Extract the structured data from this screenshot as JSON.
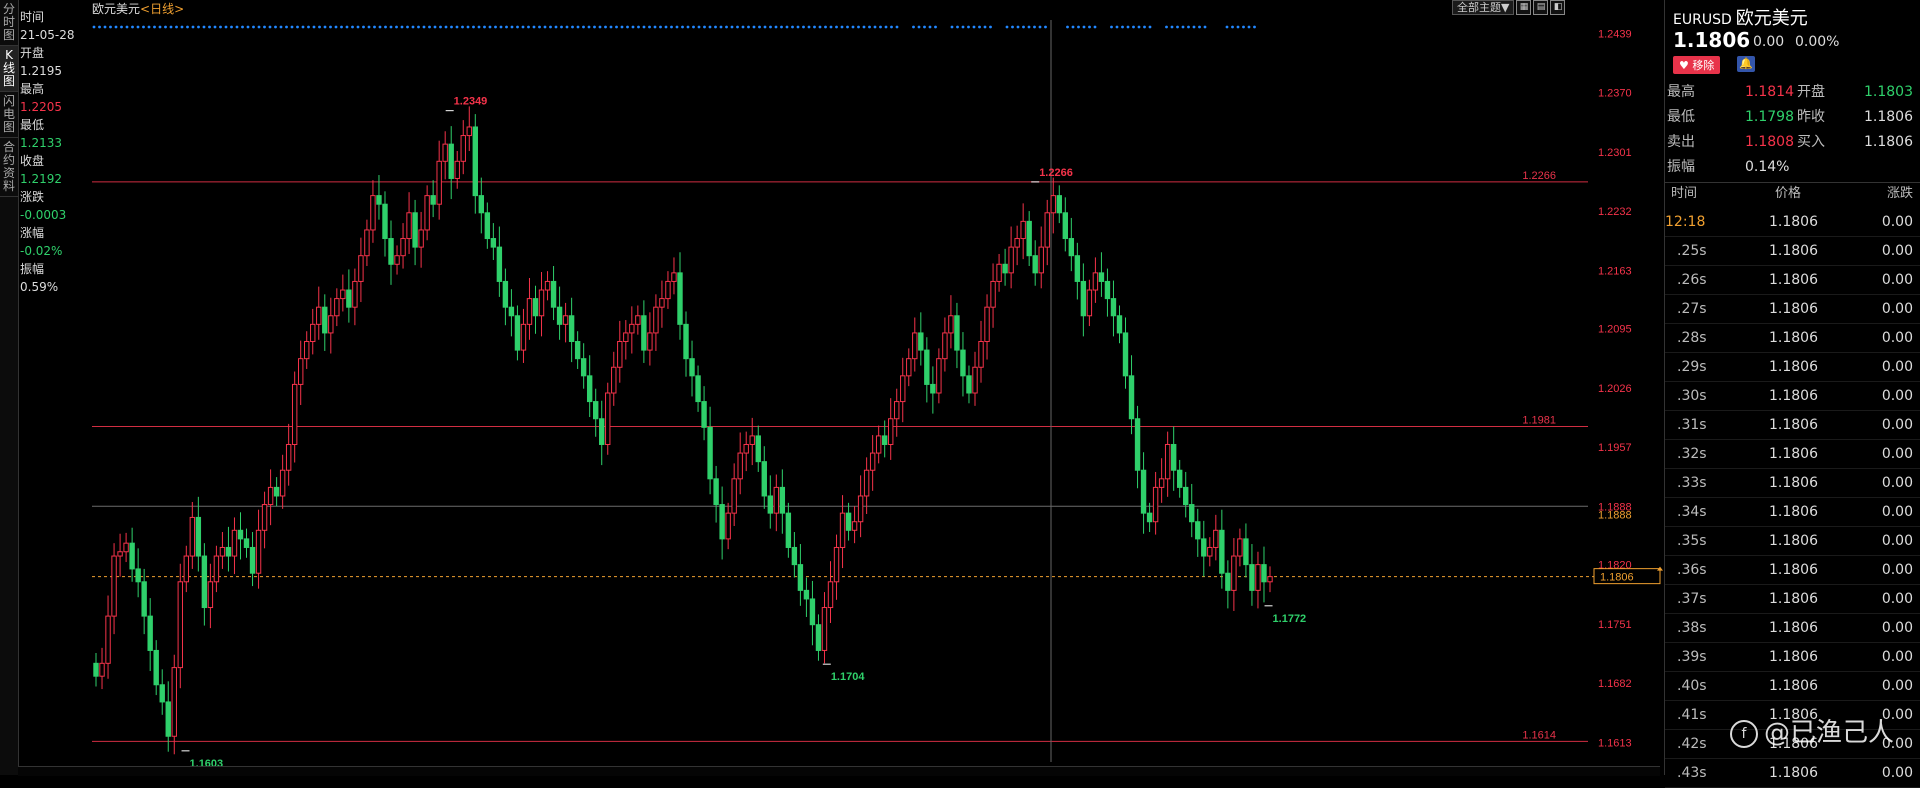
{
  "left_tabs": [
    "分时图",
    "K线图",
    "闪电图",
    "合约资料"
  ],
  "info": {
    "time_label": "时间",
    "time": "21-05-28",
    "open_label": "开盘",
    "open": "1.2195",
    "high_label": "最高",
    "high": "1.2205",
    "low_label": "最低",
    "low": "1.2133",
    "close_label": "收盘",
    "close": "1.2192",
    "change_label": "涨跌",
    "change": "-0.0003",
    "change_pct_label": "涨幅",
    "change_pct": "-0.02%",
    "amplitude_label": "振幅",
    "amplitude": "0.59%"
  },
  "chart_header": {
    "name": "欧元美元",
    "period": "<日线>"
  },
  "toolbar": {
    "theme_label": "全部主题▼",
    "icons": [
      "layout-icon",
      "layout2-icon",
      "close-icon"
    ]
  },
  "chart_data": {
    "type": "candlestick",
    "y_ticks_right": [
      "1.2439",
      "1.2370",
      "1.2301",
      "1.2232",
      "1.2163",
      "1.2095",
      "1.2026",
      "1.1957",
      "1.1888",
      "1.1820",
      "1.1751",
      "1.1682",
      "1.1613"
    ],
    "y_ticks_left": [
      "1.2095",
      "1.2026",
      "1.1957",
      "1.1888",
      "1.1820",
      "1.1751",
      "1.1682",
      "1.1613"
    ],
    "ylim": [
      1.159,
      1.245
    ],
    "hlines": [
      {
        "value": 1.2266,
        "label": "1.2266",
        "color": "#e8334a"
      },
      {
        "value": 1.1981,
        "label": "1.1981",
        "color": "#e8334a"
      },
      {
        "value": 1.1614,
        "label": "1.1614",
        "color": "#e8334a"
      },
      {
        "value": 1.1888,
        "label": "1.1888",
        "color": "#888888"
      }
    ],
    "current_price": {
      "value": 1.1806,
      "label": "1.1806",
      "upper_label": "1.1888"
    },
    "annotations": [
      {
        "label": "1.2349",
        "value": 1.2349,
        "color": "#f5334a",
        "pos": 0.241
      },
      {
        "label": "1.2266",
        "value": 1.2266,
        "color": "#f5334a",
        "pos": 0.64
      },
      {
        "label": "1.1603",
        "value": 1.1603,
        "color": "#2fd06b",
        "pos": 0.061
      },
      {
        "label": "1.1704",
        "value": 1.1704,
        "color": "#2fd06b",
        "pos": 0.498
      },
      {
        "label": "1.1772",
        "value": 1.1772,
        "color": "#2fd06b",
        "pos": 0.799
      }
    ],
    "closes": [
      1.169,
      1.1705,
      1.176,
      1.183,
      1.1835,
      1.1845,
      1.1815,
      1.18,
      1.176,
      1.172,
      1.168,
      1.166,
      1.162,
      1.17,
      1.18,
      1.183,
      1.1875,
      1.183,
      1.177,
      1.18,
      1.183,
      1.184,
      1.183,
      1.186,
      1.185,
      1.184,
      1.181,
      1.186,
      1.189,
      1.191,
      1.19,
      1.193,
      1.196,
      1.203,
      1.206,
      1.208,
      1.21,
      1.212,
      1.209,
      1.211,
      1.213,
      1.214,
      1.212,
      1.215,
      1.218,
      1.221,
      1.225,
      1.224,
      1.22,
      1.217,
      1.218,
      1.22,
      1.223,
      1.219,
      1.221,
      1.225,
      1.224,
      1.229,
      1.231,
      1.227,
      1.229,
      1.232,
      1.233,
      1.225,
      1.223,
      1.22,
      1.219,
      1.215,
      1.212,
      1.211,
      1.207,
      1.21,
      1.213,
      1.211,
      1.214,
      1.215,
      1.212,
      1.21,
      1.211,
      1.208,
      1.206,
      1.204,
      1.201,
      1.199,
      1.196,
      1.202,
      1.205,
      1.208,
      1.209,
      1.21,
      1.211,
      1.207,
      1.209,
      1.212,
      1.213,
      1.215,
      1.216,
      1.21,
      1.206,
      1.204,
      1.201,
      1.198,
      1.192,
      1.189,
      1.185,
      1.188,
      1.192,
      1.195,
      1.196,
      1.197,
      1.194,
      1.19,
      1.188,
      1.191,
      1.188,
      1.184,
      1.182,
      1.179,
      1.178,
      1.175,
      1.172,
      1.177,
      1.18,
      1.184,
      1.188,
      1.186,
      1.187,
      1.19,
      1.193,
      1.195,
      1.197,
      1.196,
      1.199,
      1.201,
      1.204,
      1.206,
      1.209,
      1.207,
      1.203,
      1.202,
      1.206,
      1.209,
      1.211,
      1.207,
      1.204,
      1.202,
      1.205,
      1.208,
      1.212,
      1.215,
      1.217,
      1.216,
      1.219,
      1.22,
      1.222,
      1.218,
      1.216,
      1.219,
      1.223,
      1.225,
      1.223,
      1.22,
      1.218,
      1.215,
      1.211,
      1.214,
      1.216,
      1.215,
      1.213,
      1.211,
      1.209,
      1.204,
      1.199,
      1.193,
      1.188,
      1.187,
      1.191,
      1.192,
      1.196,
      1.193,
      1.191,
      1.189,
      1.187,
      1.185,
      1.183,
      1.184,
      1.186,
      1.181,
      1.179,
      1.183,
      1.185,
      1.182,
      1.179,
      1.182,
      1.18,
      1.1806
    ],
    "dots_top": true
  },
  "right_panel": {
    "symbol": "EURUSD",
    "symbol_cn": "欧元美元",
    "price": "1.1806",
    "change": "0.00",
    "change_pct": "0.00%",
    "fav_label": "移除",
    "stats": [
      {
        "l1": "最高",
        "v1": "1.1814",
        "c1": "#f5334a",
        "l2": "开盘",
        "v2": "1.1803",
        "c2": "#2fd06b"
      },
      {
        "l1": "最低",
        "v1": "1.1798",
        "c1": "#2fd06b",
        "l2": "昨收",
        "v2": "1.1806",
        "c2": "#dddddd"
      },
      {
        "l1": "卖出",
        "v1": "1.1808",
        "c1": "#f5334a",
        "l2": "买入",
        "v2": "1.1806",
        "c2": "#dddddd"
      },
      {
        "l1": "振幅",
        "v1": "0.14%",
        "c1": "#dddddd",
        "l2": "",
        "v2": "",
        "c2": "#dddddd"
      }
    ],
    "tick_headers": [
      "时间",
      "价格",
      "涨跌"
    ],
    "ticks": [
      {
        "time": "12:18",
        "price": "1.1806",
        "chg": "0.00",
        "highlight": true
      },
      {
        "time": ".25s",
        "price": "1.1806",
        "chg": "0.00"
      },
      {
        "time": ".26s",
        "price": "1.1806",
        "chg": "0.00"
      },
      {
        "time": ".27s",
        "price": "1.1806",
        "chg": "0.00"
      },
      {
        "time": ".28s",
        "price": "1.1806",
        "chg": "0.00"
      },
      {
        "time": ".29s",
        "price": "1.1806",
        "chg": "0.00"
      },
      {
        "time": ".30s",
        "price": "1.1806",
        "chg": "0.00"
      },
      {
        "time": ".31s",
        "price": "1.1806",
        "chg": "0.00"
      },
      {
        "time": ".32s",
        "price": "1.1806",
        "chg": "0.00"
      },
      {
        "time": ".33s",
        "price": "1.1806",
        "chg": "0.00"
      },
      {
        "time": ".34s",
        "price": "1.1806",
        "chg": "0.00"
      },
      {
        "time": ".35s",
        "price": "1.1806",
        "chg": "0.00"
      },
      {
        "time": ".36s",
        "price": "1.1806",
        "chg": "0.00"
      },
      {
        "time": ".37s",
        "price": "1.1806",
        "chg": "0.00"
      },
      {
        "time": ".38s",
        "price": "1.1806",
        "chg": "0.00"
      },
      {
        "time": ".39s",
        "price": "1.1806",
        "chg": "0.00"
      },
      {
        "time": ".40s",
        "price": "1.1806",
        "chg": "0.00"
      },
      {
        "time": ".41s",
        "price": "1.1806",
        "chg": "0.00"
      },
      {
        "time": ".42s",
        "price": "1.1806",
        "chg": "0.00"
      },
      {
        "time": ".43s",
        "price": "1.1806",
        "chg": "0.00"
      }
    ]
  },
  "watermark": "@已渔己人",
  "colors": {
    "up": "#f5334a",
    "down": "#2fd06b",
    "dot": "#2288ff",
    "price_line": "#f0a030"
  }
}
